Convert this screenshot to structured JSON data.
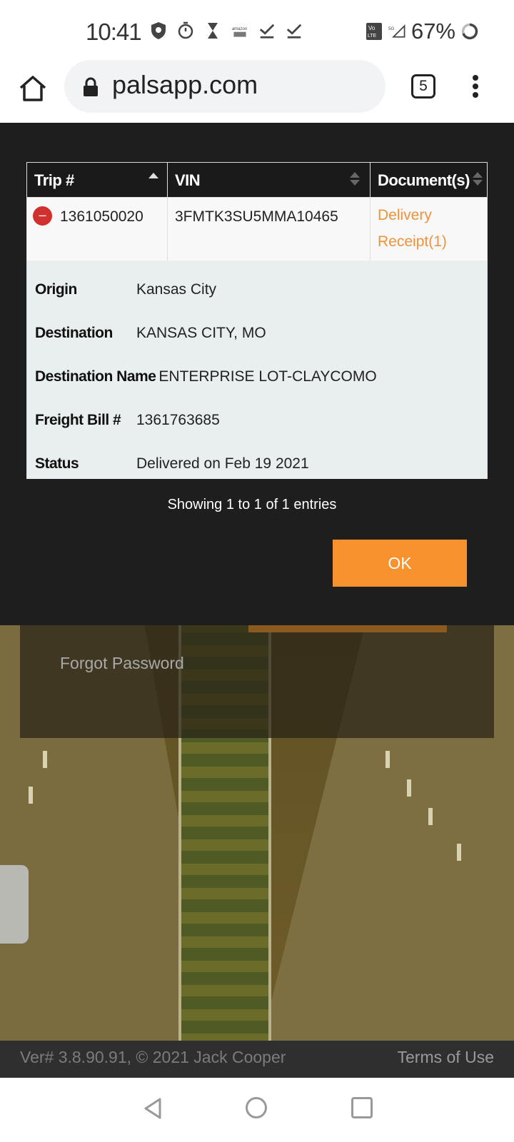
{
  "status_bar": {
    "time": "10:41",
    "battery": "67%"
  },
  "browser": {
    "url": "palsapp.com",
    "tab_count": "5"
  },
  "modal": {
    "table": {
      "columns": [
        "Trip #",
        "VIN",
        "Document(s)"
      ],
      "row": {
        "trip": "1361050020",
        "vin": "3FMTK3SU5MMA10465",
        "document_line1": "Delivery",
        "document_line2": "Receipt(1)"
      },
      "details": [
        {
          "label": "Origin",
          "value": "Kansas City"
        },
        {
          "label": "Destination",
          "value": "KANSAS CITY, MO"
        },
        {
          "label": "Destination Name",
          "value": "ENTERPRISE LOT-CLAYCOMO"
        },
        {
          "label": "Freight Bill #",
          "value": "1361763685"
        },
        {
          "label": "Status",
          "value": "Delivered on Feb 19 2021"
        }
      ]
    },
    "info": "Showing 1 to 1 of 1 entries",
    "ok_label": "OK"
  },
  "login": {
    "forgot_password": "Forgot Password"
  },
  "footer": {
    "version": "Ver# 3.8.90.91, © 2021 Jack Cooper",
    "terms": "Terms of Use"
  },
  "colors": {
    "accent": "#f7922e",
    "link": "#f1923a",
    "modal_bg": "#1e1e1e",
    "collapse": "#d0312d"
  }
}
